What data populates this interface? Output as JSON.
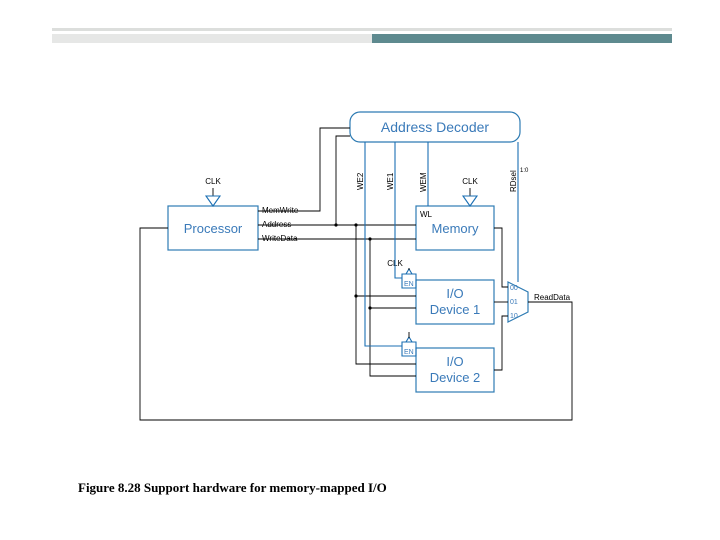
{
  "caption": "Figure 8.28 Support hardware for memory-mapped I/O",
  "blocks": {
    "decoder": "Address Decoder",
    "processor": "Processor",
    "memory": "Memory",
    "io1_l1": "I/O",
    "io1_l2": "Device 1",
    "io2_l1": "I/O",
    "io2_l2": "Device 2"
  },
  "signals": {
    "clk": "CLK",
    "memwrite": "MemWrite",
    "address": "Address",
    "writedata": "WriteData",
    "we2": "WE2",
    "we1": "WE1",
    "wem": "WEM",
    "rdsel": "RDsel",
    "rdsel_sub": "1:0",
    "wl": "WL",
    "readdata": "ReadData",
    "en": "EN",
    "mux00": "00",
    "mux01": "01",
    "mux10": "10"
  }
}
